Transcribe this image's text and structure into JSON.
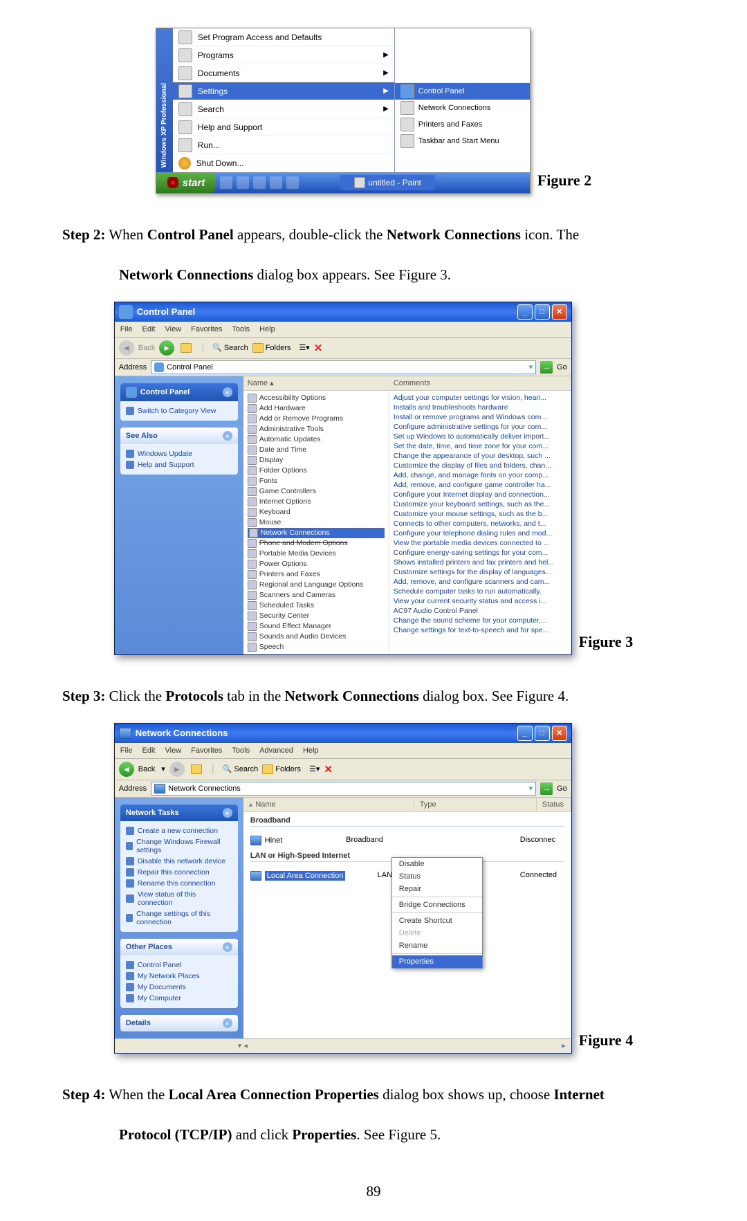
{
  "page_number": "89",
  "step2": {
    "prefix": "Step 2:",
    "line1a": " When ",
    "cp": "Control Panel",
    "line1b": " appears, double-click the ",
    "nc": "Network Connections",
    "line1c": " icon. The",
    "line2a": "Network Connections",
    "line2b": " dialog box appears. See Figure 3."
  },
  "step3": {
    "prefix": "Step 3:",
    "a": " Click the ",
    "proto": "Protocols",
    "b": " tab in the ",
    "nc": "Network Connections",
    "c": " dialog box. See Figure 4."
  },
  "step4": {
    "prefix": "Step 4:",
    "a": " When the ",
    "lacp": "Local Area Connection Properties",
    "b": " dialog box shows up, choose ",
    "inet": "Internet",
    "line2a": "Protocol (TCP/IP)",
    "line2b": " and click ",
    "props": "Properties",
    "line2c": ". See Figure 5."
  },
  "figure_labels": {
    "f2": "Figure 2",
    "f3": "Figure 3",
    "f4": "Figure 4"
  },
  "fig2": {
    "sidebar": "Windows XP Professional",
    "menu": {
      "set_program": "Set Program Access and Defaults",
      "programs": "Programs",
      "documents": "Documents",
      "settings": "Settings",
      "search": "Search",
      "help": "Help and Support",
      "run": "Run...",
      "shutdown": "Shut Down..."
    },
    "submenu": {
      "control_panel": "Control Panel",
      "netconn": "Network Connections",
      "printers": "Printers and Faxes",
      "taskbar": "Taskbar and Start Menu"
    },
    "taskbar": {
      "start": "start",
      "app": "untitled - Paint"
    }
  },
  "fig3": {
    "title": "Control Panel",
    "menu": [
      "File",
      "Edit",
      "View",
      "Favorites",
      "Tools",
      "Help"
    ],
    "tb": {
      "back": "Back",
      "search": "Search",
      "folders": "Folders"
    },
    "addr": {
      "label": "Address",
      "value": "Control Panel",
      "go": "Go"
    },
    "side": {
      "panel1": {
        "title": "Control Panel",
        "item": "Switch to Category View"
      },
      "panel2": {
        "title": "See Also",
        "items": [
          "Windows Update",
          "Help and Support"
        ]
      }
    },
    "columns": [
      "Name",
      "Comments"
    ],
    "rows": [
      {
        "n": "Accessibility Options",
        "c": "Adjust your computer settings for vision, heari..."
      },
      {
        "n": "Add Hardware",
        "c": "Installs and troubleshoots hardware"
      },
      {
        "n": "Add or Remove Programs",
        "c": "Install or remove programs and Windows com..."
      },
      {
        "n": "Administrative Tools",
        "c": "Configure administrative settings for your com..."
      },
      {
        "n": "Automatic Updates",
        "c": "Set up Windows to automatically deliver import..."
      },
      {
        "n": "Date and Time",
        "c": "Set the date, time, and time zone for your com..."
      },
      {
        "n": "Display",
        "c": "Change the appearance of your desktop, such ..."
      },
      {
        "n": "Folder Options",
        "c": "Customize the display of files and folders, chan..."
      },
      {
        "n": "Fonts",
        "c": "Add, change, and manage fonts on your comp..."
      },
      {
        "n": "Game Controllers",
        "c": "Add, remove, and configure game controller ha..."
      },
      {
        "n": "Internet Options",
        "c": "Configure your Internet display and connection..."
      },
      {
        "n": "Keyboard",
        "c": "Customize your keyboard settings, such as the..."
      },
      {
        "n": "Mouse",
        "c": "Customize your mouse settings, such as the b..."
      },
      {
        "n": "Network Connections",
        "c": "Connects to other computers, networks, and t...",
        "hl": true
      },
      {
        "n": "Phone and Modem Options",
        "c": "Configure your telephone dialing rules and mod...",
        "struck": true
      },
      {
        "n": "Portable Media Devices",
        "c": "View the portable media devices connected to ..."
      },
      {
        "n": "Power Options",
        "c": "Configure energy-saving settings for your com..."
      },
      {
        "n": "Printers and Faxes",
        "c": "Shows installed printers and fax printers and hel..."
      },
      {
        "n": "Regional and Language Options",
        "c": "Customize settings for the display of languages..."
      },
      {
        "n": "Scanners and Cameras",
        "c": "Add, remove, and configure scanners and cam..."
      },
      {
        "n": "Scheduled Tasks",
        "c": "Schedule computer tasks to run automatically."
      },
      {
        "n": "Security Center",
        "c": "View your current security status and access i..."
      },
      {
        "n": "Sound Effect Manager",
        "c": "AC97 Audio Control Panel"
      },
      {
        "n": "Sounds and Audio Devices",
        "c": "Change the sound scheme for your computer,..."
      },
      {
        "n": "Speech",
        "c": "Change settings for text-to-speech and for spe..."
      }
    ]
  },
  "fig4": {
    "title": "Network Connections",
    "menu": [
      "File",
      "Edit",
      "View",
      "Favorites",
      "Tools",
      "Advanced",
      "Help"
    ],
    "tb": {
      "back": "Back",
      "search": "Search",
      "folders": "Folders"
    },
    "addr": {
      "label": "Address",
      "value": "Network Connections",
      "go": "Go"
    },
    "side": {
      "panel1": {
        "title": "Network Tasks",
        "items": [
          "Create a new connection",
          "Change Windows Firewall settings",
          "Disable this network device",
          "Repair this connection",
          "Rename this connection",
          "View status of this connection",
          "Change settings of this connection"
        ]
      },
      "panel2": {
        "title": "Other Places",
        "items": [
          "Control Panel",
          "My Network Places",
          "My Documents",
          "My Computer"
        ]
      },
      "panel3": {
        "title": "Details"
      }
    },
    "columns": {
      "name": "Name",
      "type": "Type",
      "status": "Status"
    },
    "groups": {
      "bb": {
        "title": "Broadband",
        "row": {
          "name": "Hinet",
          "type": "Broadband",
          "status": "Disconnec"
        }
      },
      "lan": {
        "title": "LAN or High-Speed Internet",
        "row": {
          "name": "Local Area Connection",
          "type": "LAN or High-Speed Internet",
          "status": "Connected"
        }
      }
    },
    "context": [
      "Disable",
      "Status",
      "Repair",
      "Bridge Connections",
      "Create Shortcut",
      "Delete",
      "Rename",
      "Properties"
    ]
  }
}
